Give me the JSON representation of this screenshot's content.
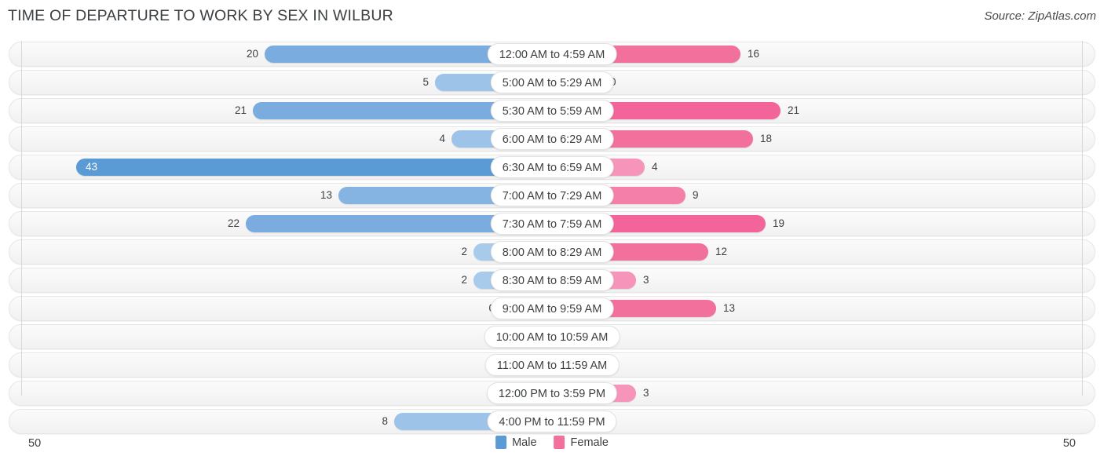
{
  "header": {
    "title": "TIME OF DEPARTURE TO WORK BY SEX IN WILBUR",
    "source": "Source: ZipAtlas.com"
  },
  "legend": {
    "male_label": "Male",
    "female_label": "Female",
    "male_color": "#5b9bd5",
    "female_color": "#f2709c"
  },
  "axis": {
    "left_max": "50",
    "right_max": "50"
  },
  "chart_data": {
    "type": "bar",
    "orientation": "horizontal-diverging",
    "title": "Time of Departure to Work by Sex in Wilbur",
    "xlabel": "",
    "ylabel": "",
    "xlim": [
      0,
      50
    ],
    "grid": false,
    "legend_position": "bottom-center",
    "categories": [
      "12:00 AM to 4:59 AM",
      "5:00 AM to 5:29 AM",
      "5:30 AM to 5:59 AM",
      "6:00 AM to 6:29 AM",
      "6:30 AM to 6:59 AM",
      "7:00 AM to 7:29 AM",
      "7:30 AM to 7:59 AM",
      "8:00 AM to 8:29 AM",
      "8:30 AM to 8:59 AM",
      "9:00 AM to 9:59 AM",
      "10:00 AM to 10:59 AM",
      "11:00 AM to 11:59 AM",
      "12:00 PM to 3:59 PM",
      "4:00 PM to 11:59 PM"
    ],
    "series": [
      {
        "name": "Male",
        "values": [
          20,
          5,
          21,
          4,
          43,
          13,
          22,
          2,
          2,
          0,
          0,
          0,
          0,
          8
        ]
      },
      {
        "name": "Female",
        "values": [
          16,
          0,
          21,
          18,
          4,
          9,
          19,
          12,
          3,
          13,
          0,
          0,
          3,
          0
        ]
      }
    ]
  },
  "rows": [
    {
      "label": "12:00 AM to 4:59 AM",
      "male": "20",
      "female": "16",
      "male_w": 366,
      "female_w": 240,
      "male_c": "#7bacdf",
      "female_c": "#f2709c",
      "male_inside": false
    },
    {
      "label": "5:00 AM to 5:29 AM",
      "male": "5",
      "female": "0",
      "male_w": 149,
      "female_w": 65,
      "male_c": "#9ec3e8",
      "female_c": "#f9a8c4",
      "male_inside": false
    },
    {
      "label": "5:30 AM to 5:59 AM",
      "male": "21",
      "female": "21",
      "male_w": 381,
      "female_w": 291,
      "male_c": "#7bacdf",
      "female_c": "#f2649a",
      "male_inside": false
    },
    {
      "label": "6:00 AM to 6:29 AM",
      "male": "4",
      "female": "18",
      "male_w": 128,
      "female_w": 256,
      "male_c": "#9ec3e8",
      "female_c": "#f2709c",
      "male_inside": false
    },
    {
      "label": "6:30 AM to 6:59 AM",
      "male": "43",
      "female": "4",
      "male_w": 606,
      "female_w": 118,
      "male_c": "#5b9bd5",
      "female_c": "#f794ba",
      "male_inside": true
    },
    {
      "label": "7:00 AM to 7:29 AM",
      "male": "13",
      "female": "9",
      "male_w": 272,
      "female_w": 170,
      "male_c": "#85b3e2",
      "female_c": "#f47fa8",
      "male_inside": false
    },
    {
      "label": "7:30 AM to 7:59 AM",
      "male": "22",
      "female": "19",
      "male_w": 390,
      "female_w": 272,
      "male_c": "#7bacdf",
      "female_c": "#f2649a",
      "male_inside": false
    },
    {
      "label": "8:00 AM to 8:29 AM",
      "male": "2",
      "female": "12",
      "male_w": 100,
      "female_w": 199,
      "male_c": "#a8caeb",
      "female_c": "#f2709c",
      "male_inside": false
    },
    {
      "label": "8:30 AM to 8:59 AM",
      "male": "2",
      "female": "3",
      "male_w": 100,
      "female_w": 107,
      "male_c": "#a8caeb",
      "female_c": "#f794ba",
      "male_inside": false
    },
    {
      "label": "9:00 AM to 9:59 AM",
      "male": "0",
      "female": "13",
      "male_w": 65,
      "female_w": 209,
      "male_c": "#a8caeb",
      "female_c": "#f2709c",
      "male_inside": false
    },
    {
      "label": "10:00 AM to 10:59 AM",
      "male": "0",
      "female": "0",
      "male_w": 65,
      "female_w": 65,
      "male_c": "#a8caeb",
      "female_c": "#f794ba",
      "male_inside": false
    },
    {
      "label": "11:00 AM to 11:59 AM",
      "male": "0",
      "female": "0",
      "male_w": 65,
      "female_w": 65,
      "male_c": "#a8caeb",
      "female_c": "#f794ba",
      "male_inside": false
    },
    {
      "label": "12:00 PM to 3:59 PM",
      "male": "0",
      "female": "3",
      "male_w": 65,
      "female_w": 107,
      "male_c": "#a8caeb",
      "female_c": "#f794ba",
      "male_inside": false
    },
    {
      "label": "4:00 PM to 11:59 PM",
      "male": "8",
      "female": "0",
      "male_w": 201,
      "female_w": 65,
      "male_c": "#9ec3e8",
      "female_c": "#f794ba",
      "male_inside": false
    }
  ]
}
